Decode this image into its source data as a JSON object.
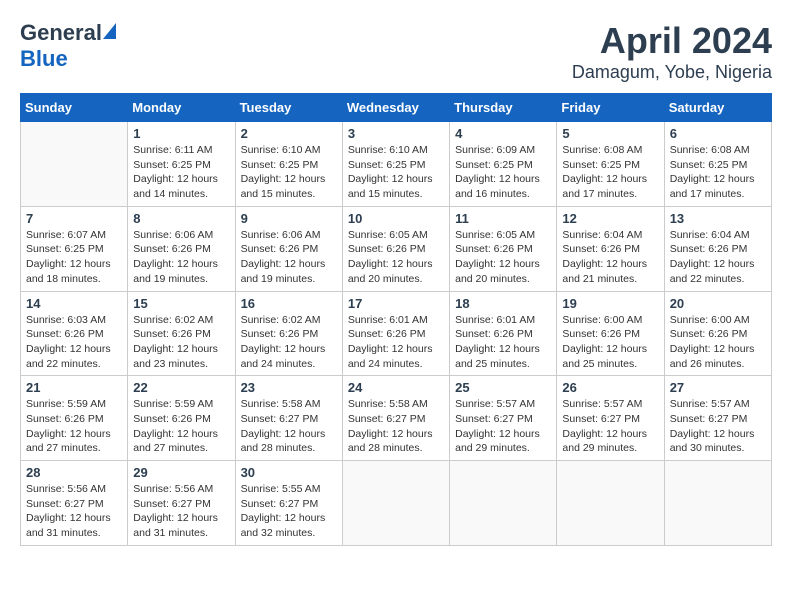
{
  "header": {
    "logo_general": "General",
    "logo_blue": "Blue",
    "title": "April 2024",
    "subtitle": "Damagum, Yobe, Nigeria"
  },
  "calendar": {
    "headers": [
      "Sunday",
      "Monday",
      "Tuesday",
      "Wednesday",
      "Thursday",
      "Friday",
      "Saturday"
    ],
    "weeks": [
      [
        {
          "day": "",
          "info": ""
        },
        {
          "day": "1",
          "info": "Sunrise: 6:11 AM\nSunset: 6:25 PM\nDaylight: 12 hours\nand 14 minutes."
        },
        {
          "day": "2",
          "info": "Sunrise: 6:10 AM\nSunset: 6:25 PM\nDaylight: 12 hours\nand 15 minutes."
        },
        {
          "day": "3",
          "info": "Sunrise: 6:10 AM\nSunset: 6:25 PM\nDaylight: 12 hours\nand 15 minutes."
        },
        {
          "day": "4",
          "info": "Sunrise: 6:09 AM\nSunset: 6:25 PM\nDaylight: 12 hours\nand 16 minutes."
        },
        {
          "day": "5",
          "info": "Sunrise: 6:08 AM\nSunset: 6:25 PM\nDaylight: 12 hours\nand 17 minutes."
        },
        {
          "day": "6",
          "info": "Sunrise: 6:08 AM\nSunset: 6:25 PM\nDaylight: 12 hours\nand 17 minutes."
        }
      ],
      [
        {
          "day": "7",
          "info": "Sunrise: 6:07 AM\nSunset: 6:25 PM\nDaylight: 12 hours\nand 18 minutes."
        },
        {
          "day": "8",
          "info": "Sunrise: 6:06 AM\nSunset: 6:26 PM\nDaylight: 12 hours\nand 19 minutes."
        },
        {
          "day": "9",
          "info": "Sunrise: 6:06 AM\nSunset: 6:26 PM\nDaylight: 12 hours\nand 19 minutes."
        },
        {
          "day": "10",
          "info": "Sunrise: 6:05 AM\nSunset: 6:26 PM\nDaylight: 12 hours\nand 20 minutes."
        },
        {
          "day": "11",
          "info": "Sunrise: 6:05 AM\nSunset: 6:26 PM\nDaylight: 12 hours\nand 20 minutes."
        },
        {
          "day": "12",
          "info": "Sunrise: 6:04 AM\nSunset: 6:26 PM\nDaylight: 12 hours\nand 21 minutes."
        },
        {
          "day": "13",
          "info": "Sunrise: 6:04 AM\nSunset: 6:26 PM\nDaylight: 12 hours\nand 22 minutes."
        }
      ],
      [
        {
          "day": "14",
          "info": "Sunrise: 6:03 AM\nSunset: 6:26 PM\nDaylight: 12 hours\nand 22 minutes."
        },
        {
          "day": "15",
          "info": "Sunrise: 6:02 AM\nSunset: 6:26 PM\nDaylight: 12 hours\nand 23 minutes."
        },
        {
          "day": "16",
          "info": "Sunrise: 6:02 AM\nSunset: 6:26 PM\nDaylight: 12 hours\nand 24 minutes."
        },
        {
          "day": "17",
          "info": "Sunrise: 6:01 AM\nSunset: 6:26 PM\nDaylight: 12 hours\nand 24 minutes."
        },
        {
          "day": "18",
          "info": "Sunrise: 6:01 AM\nSunset: 6:26 PM\nDaylight: 12 hours\nand 25 minutes."
        },
        {
          "day": "19",
          "info": "Sunrise: 6:00 AM\nSunset: 6:26 PM\nDaylight: 12 hours\nand 25 minutes."
        },
        {
          "day": "20",
          "info": "Sunrise: 6:00 AM\nSunset: 6:26 PM\nDaylight: 12 hours\nand 26 minutes."
        }
      ],
      [
        {
          "day": "21",
          "info": "Sunrise: 5:59 AM\nSunset: 6:26 PM\nDaylight: 12 hours\nand 27 minutes."
        },
        {
          "day": "22",
          "info": "Sunrise: 5:59 AM\nSunset: 6:26 PM\nDaylight: 12 hours\nand 27 minutes."
        },
        {
          "day": "23",
          "info": "Sunrise: 5:58 AM\nSunset: 6:27 PM\nDaylight: 12 hours\nand 28 minutes."
        },
        {
          "day": "24",
          "info": "Sunrise: 5:58 AM\nSunset: 6:27 PM\nDaylight: 12 hours\nand 28 minutes."
        },
        {
          "day": "25",
          "info": "Sunrise: 5:57 AM\nSunset: 6:27 PM\nDaylight: 12 hours\nand 29 minutes."
        },
        {
          "day": "26",
          "info": "Sunrise: 5:57 AM\nSunset: 6:27 PM\nDaylight: 12 hours\nand 29 minutes."
        },
        {
          "day": "27",
          "info": "Sunrise: 5:57 AM\nSunset: 6:27 PM\nDaylight: 12 hours\nand 30 minutes."
        }
      ],
      [
        {
          "day": "28",
          "info": "Sunrise: 5:56 AM\nSunset: 6:27 PM\nDaylight: 12 hours\nand 31 minutes."
        },
        {
          "day": "29",
          "info": "Sunrise: 5:56 AM\nSunset: 6:27 PM\nDaylight: 12 hours\nand 31 minutes."
        },
        {
          "day": "30",
          "info": "Sunrise: 5:55 AM\nSunset: 6:27 PM\nDaylight: 12 hours\nand 32 minutes."
        },
        {
          "day": "",
          "info": ""
        },
        {
          "day": "",
          "info": ""
        },
        {
          "day": "",
          "info": ""
        },
        {
          "day": "",
          "info": ""
        }
      ]
    ]
  }
}
